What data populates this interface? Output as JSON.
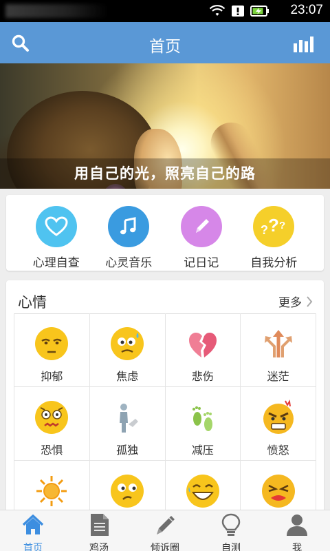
{
  "status_bar": {
    "time": "23:07"
  },
  "header": {
    "title": "首页"
  },
  "banner": {
    "caption": "用自己的光，照亮自己的路"
  },
  "features": [
    {
      "label": "心理自查",
      "icon": "heart-icon",
      "color": "#4fc3f0"
    },
    {
      "label": "心灵音乐",
      "icon": "music-note-icon",
      "color": "#3a9be0"
    },
    {
      "label": "记日记",
      "icon": "pencil-icon",
      "color": "#d687e8"
    },
    {
      "label": "自我分析",
      "icon": "question-marks-icon",
      "color": "#f5cf2a"
    }
  ],
  "mood": {
    "title": "心情",
    "more_label": "更多",
    "items": [
      {
        "label": "抑郁",
        "icon": "depressed-face-icon"
      },
      {
        "label": "焦虑",
        "icon": "anxious-face-icon"
      },
      {
        "label": "悲伤",
        "icon": "broken-heart-icon"
      },
      {
        "label": "迷茫",
        "icon": "crossroads-arrows-icon"
      },
      {
        "label": "恐惧",
        "icon": "scared-face-icon"
      },
      {
        "label": "孤独",
        "icon": "lonely-figure-icon"
      },
      {
        "label": "减压",
        "icon": "footprints-icon"
      },
      {
        "label": "愤怒",
        "icon": "angry-face-icon"
      },
      {
        "label": "",
        "icon": "sun-icon"
      },
      {
        "label": "",
        "icon": "puzzled-face-icon"
      },
      {
        "label": "",
        "icon": "laughing-face-icon"
      },
      {
        "label": "",
        "icon": "crying-face-icon"
      }
    ]
  },
  "tabbar": [
    {
      "label": "首页",
      "icon": "home-icon",
      "active": true
    },
    {
      "label": "鸡汤",
      "icon": "document-icon",
      "active": false
    },
    {
      "label": "倾诉圈",
      "icon": "pen-icon",
      "active": false
    },
    {
      "label": "自测",
      "icon": "lightbulb-icon",
      "active": false
    },
    {
      "label": "我",
      "icon": "person-icon",
      "active": false
    }
  ],
  "colors": {
    "header": "#5a98d6",
    "accent": "#3d8ee0",
    "emoji_yellow": "#f8c51c"
  }
}
